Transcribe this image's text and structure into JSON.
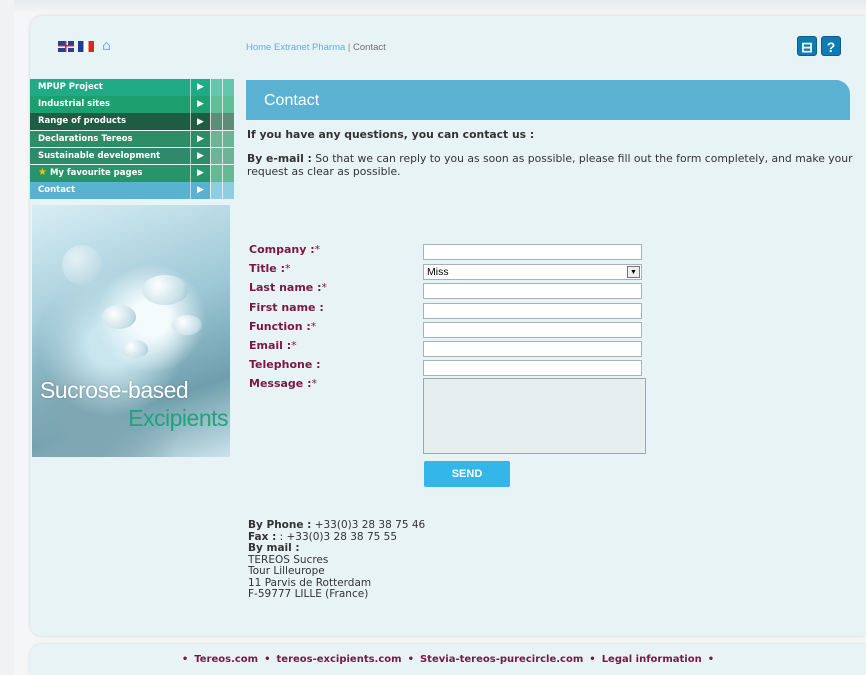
{
  "breadcrumb": {
    "home": "Home Extranet Pharma",
    "separator": "|",
    "current": "Contact"
  },
  "header": {
    "flags": [
      "uk-flag-icon",
      "fr-flag-icon"
    ],
    "home_icon": "home-icon",
    "tools": [
      {
        "icon": "basket-icon",
        "glyph": "⊟"
      },
      {
        "icon": "help-icon",
        "glyph": "?"
      }
    ]
  },
  "nav": {
    "items": [
      {
        "label": "MPUP Project"
      },
      {
        "label": "Industrial sites"
      },
      {
        "label": "Range of products"
      },
      {
        "label": "Declarations Tereos"
      },
      {
        "label": "Sustainable development"
      },
      {
        "label": "My favourite pages"
      },
      {
        "label": "Contact"
      }
    ],
    "arrow": "▶"
  },
  "promo": {
    "line1": "Sucrose-based",
    "line2": "Excipients"
  },
  "content": {
    "title": "Contact",
    "question": "If you have any questions, you can contact us :",
    "email_label": "By e-mail :",
    "email_text": "So that we can reply to you as soon as possible, please fill out the form completely, and make your request as clear as possible."
  },
  "form": {
    "company_label": "Company :",
    "title_label": "Title :",
    "title_value": "Miss",
    "lastname_label": "Last name :",
    "firstname_label": "First name :",
    "function_label": "Function :",
    "email_label": "Email :",
    "telephone_label": "Telephone :",
    "message_label": "Message :",
    "required_mark": "*",
    "send_label": "SEND"
  },
  "contact": {
    "phone_label": "By Phone :",
    "phone": "+33(0)3 28 38 75 46",
    "fax_label": "Fax :",
    "fax": ": +33(0)3 28 38 75 55",
    "mail_label": "By mail :",
    "address": [
      "TEREOS Sucres",
      "Tour Lilleurope",
      "11 Parvis de Rotterdam",
      "F-59777 LILLE (France)"
    ]
  },
  "footer": {
    "links": [
      "Tereos.com",
      "tereos-excipients.com",
      "Stevia-tereos-purecircle.com",
      "Legal information"
    ],
    "bullet": "•"
  }
}
